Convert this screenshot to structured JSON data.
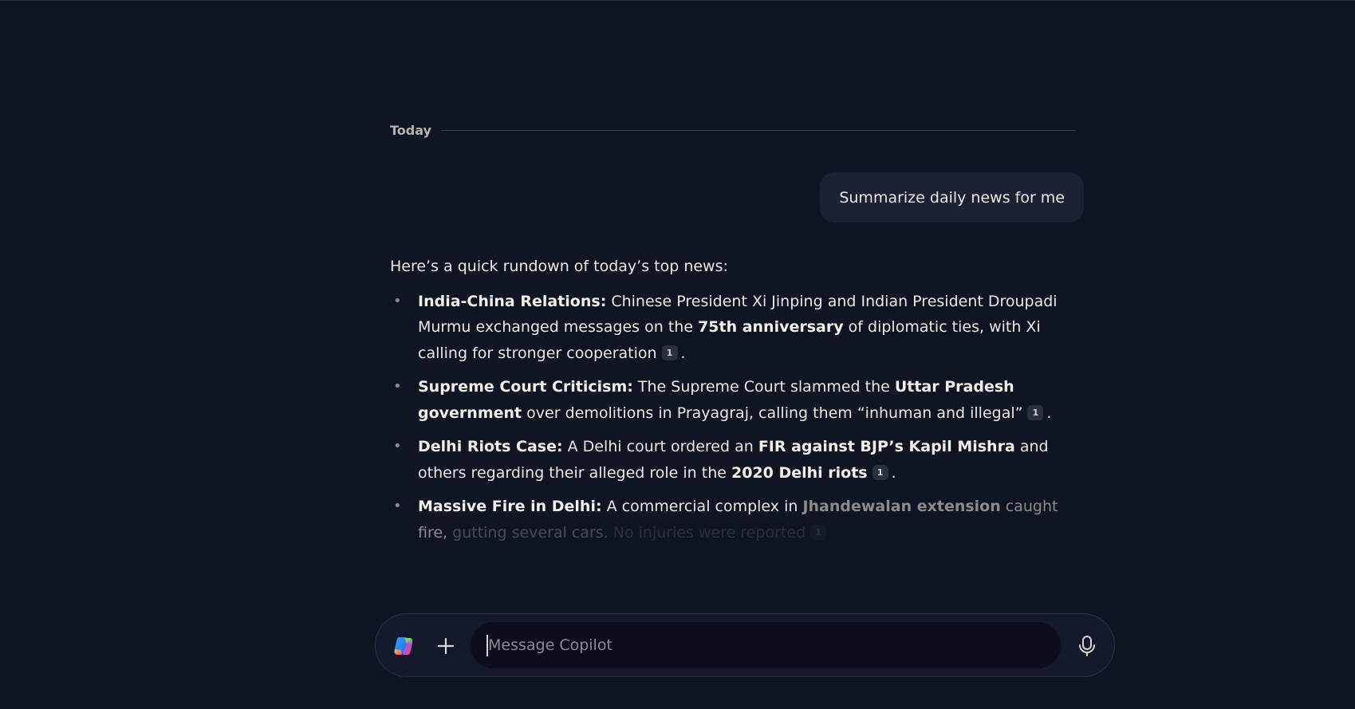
{
  "conversation": {
    "date_label": "Today",
    "user_message": "Summarize daily news for me"
  },
  "response": {
    "intro": "Here’s a quick rundown of today’s top news:",
    "items": [
      {
        "title": "India-China Relations:",
        "t1": " Chinese President Xi Jinping and Indian President Droupadi Murmu exchanged messages on the ",
        "b1": "75th anniversary",
        "t2": " of diplomatic ties, with Xi calling for stronger cooperation",
        "citation": "1",
        "end": "."
      },
      {
        "title": "Supreme Court Criticism:",
        "t1": " The Supreme Court slammed the ",
        "b1": "Uttar Pradesh government",
        "t2": " over demolitions in Prayagraj, calling them “inhuman and illegal”",
        "citation": "1",
        "end": "."
      },
      {
        "title": "Delhi Riots Case:",
        "t1": " A Delhi court ordered an ",
        "b1": "FIR against BJP’s Kapil Mishra",
        "t2": " and others regarding their alleged role in the ",
        "b2": "2020 Delhi riots",
        "citation": "1",
        "end": "."
      },
      {
        "title": "Massive Fire in Delhi:",
        "t1": " A commercial complex in ",
        "b1": "Jhandewalan extension",
        "t2": " caught fire,",
        "t3": "gutting several cars.",
        "t4": " No injuries were reported",
        "citation": "1"
      }
    ]
  },
  "composer": {
    "placeholder": "Message Copilot",
    "value": "",
    "logo_icon": "copilot-logo-icon",
    "plus_icon": "plus-icon",
    "mic_icon": "microphone-icon"
  },
  "colors": {
    "background": "#101524",
    "user_bubble": "#1c2134",
    "composer_bg": "#141a2b",
    "input_bg": "#0b0e1a",
    "text": "#ece8e2"
  }
}
